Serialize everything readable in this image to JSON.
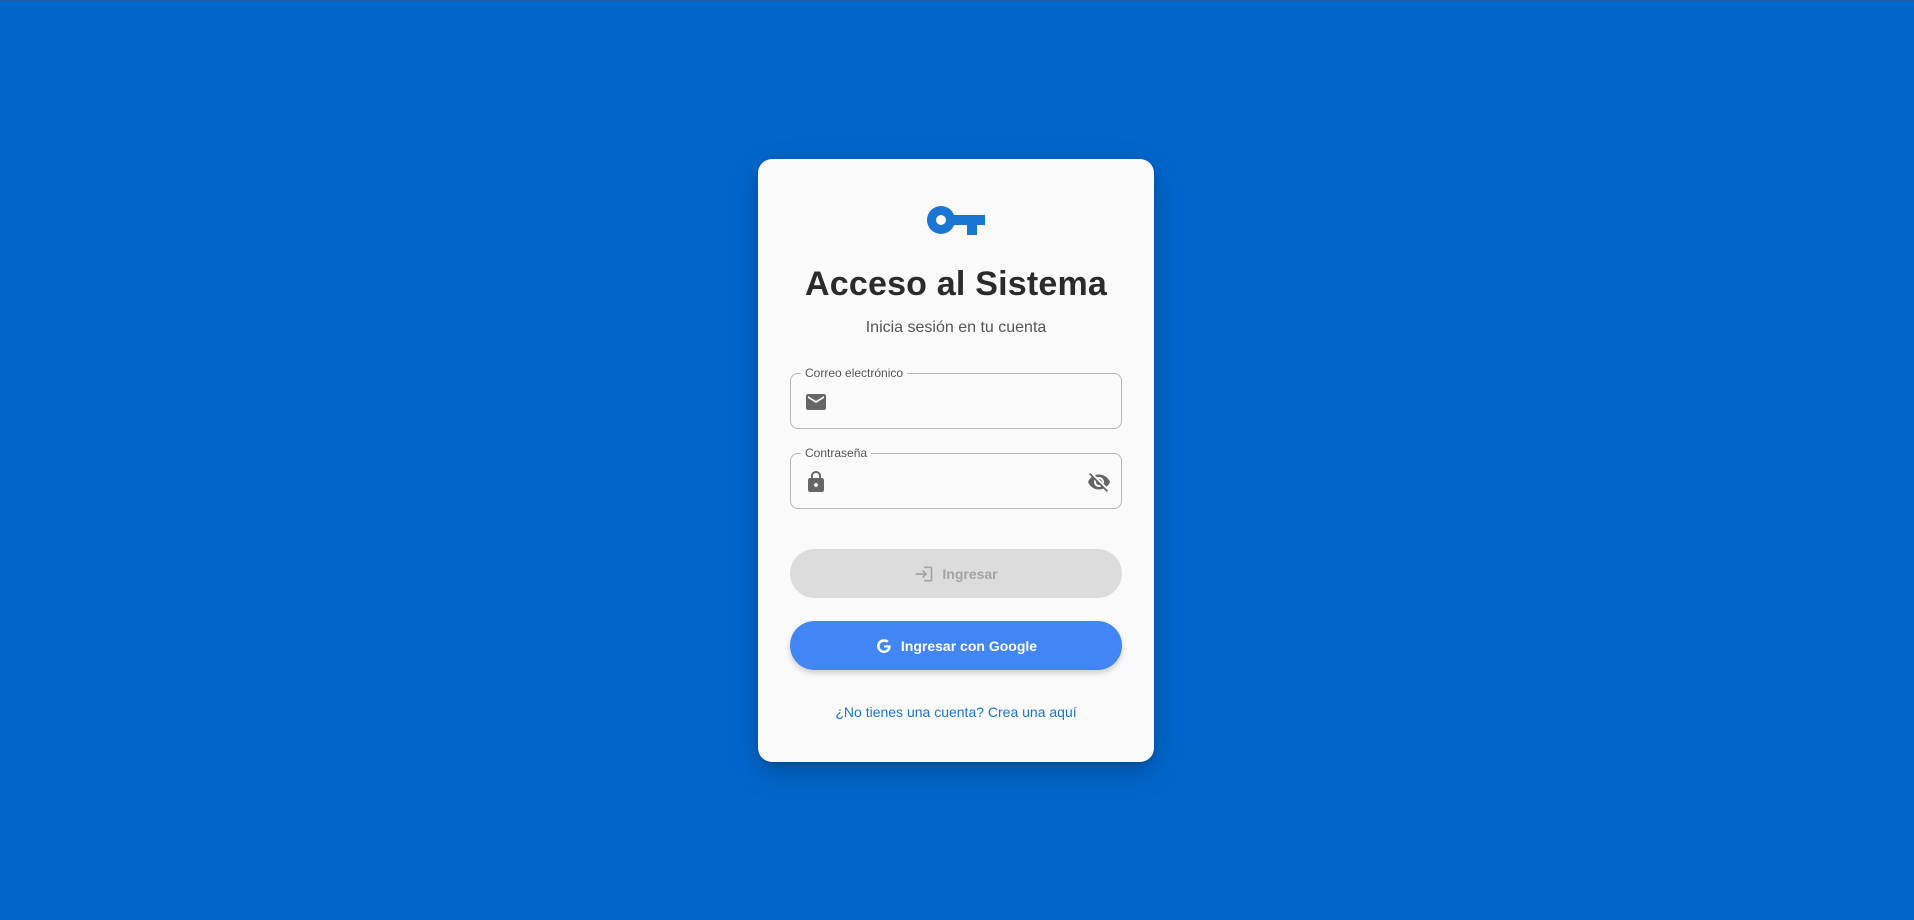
{
  "colors": {
    "background": "#0066cc",
    "card": "#fafafa",
    "accent": "#1976d2",
    "google_button": "#4285f4",
    "disabled_button": "#dcdcdc"
  },
  "header": {
    "logo_icon": "key-icon",
    "title": "Acceso al Sistema",
    "subtitle": "Inicia sesión en tu cuenta"
  },
  "form": {
    "email": {
      "label": "Correo electrónico",
      "value": "",
      "icon": "mail-icon"
    },
    "password": {
      "label": "Contraseña",
      "value": "",
      "icon": "lock-icon",
      "toggle_icon": "visibility-off-icon"
    },
    "login_button": {
      "label": "Ingresar",
      "icon": "login-icon",
      "disabled": true
    },
    "google_button": {
      "label": "Ingresar con Google",
      "icon": "google-icon"
    },
    "register_link": "¿No tienes una cuenta? Crea una aquí"
  }
}
